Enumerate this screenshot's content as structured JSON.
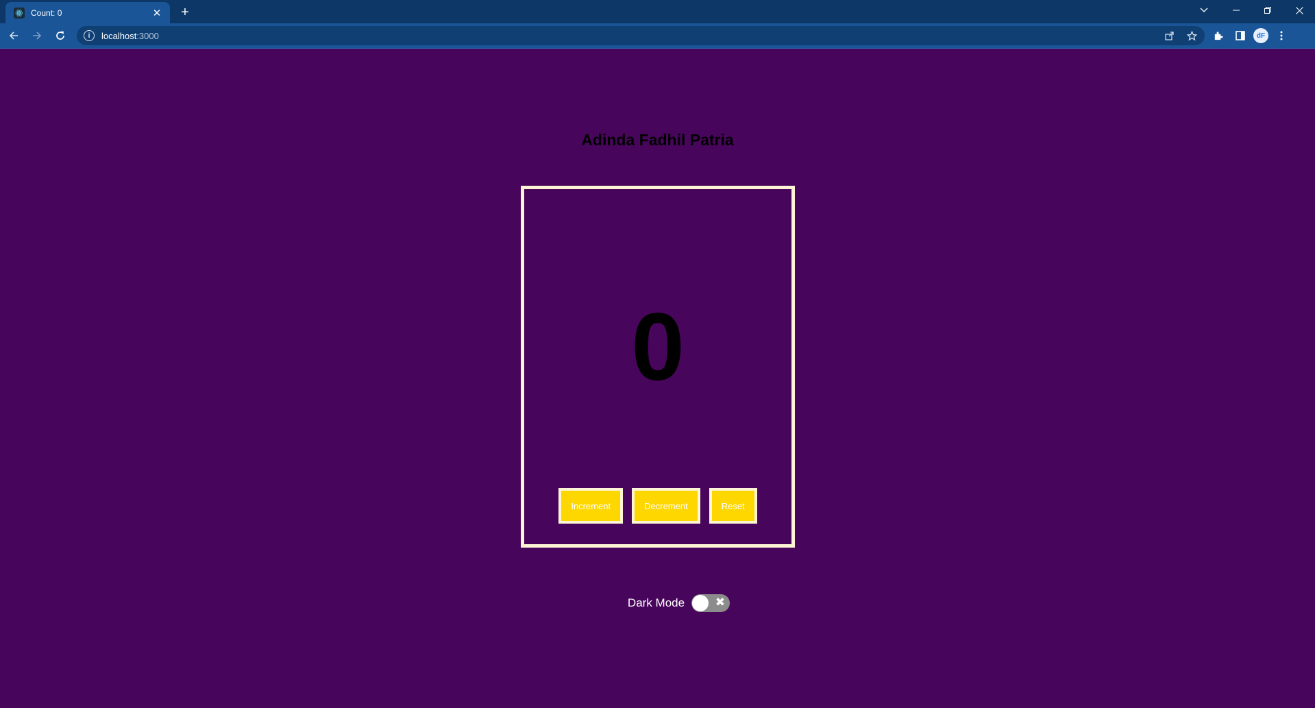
{
  "browser": {
    "tab_title": "Count: 0",
    "tab_close": "✕",
    "new_tab": "+",
    "url_host": "localhost",
    "url_port": ":3000",
    "profile_initials": "dF",
    "colors": {
      "tabstrip": "#0d3766",
      "toolbar": "#1a5597"
    }
  },
  "app": {
    "title": "Adinda Fadhil Patria",
    "count": "0",
    "buttons": {
      "increment": "Increment",
      "decrement": "Decrement",
      "reset": "Reset"
    },
    "dark_mode_label": "Dark Mode",
    "dark_mode_on": false,
    "colors": {
      "background": "#48055c",
      "card_border": "#fdf5d3",
      "button_bg": "#ffd700"
    }
  }
}
